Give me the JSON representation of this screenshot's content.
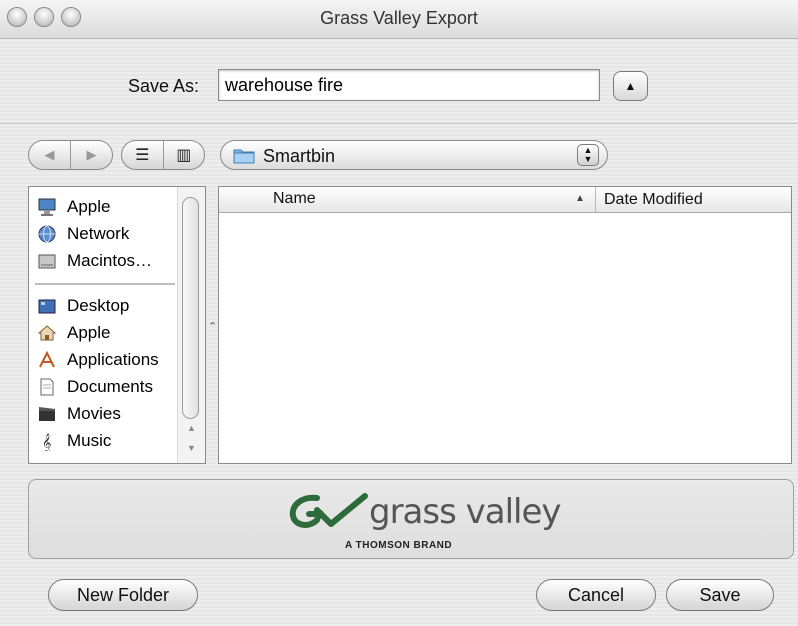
{
  "window": {
    "title": "Grass Valley Export"
  },
  "save_as": {
    "label": "Save As:",
    "value": "warehouse fire"
  },
  "toolbar": {
    "location_popup": "Smartbin"
  },
  "sidebar": {
    "items": [
      {
        "label": "Apple",
        "icon": "computer-icon"
      },
      {
        "label": "Network",
        "icon": "network-globe-icon"
      },
      {
        "label": "Macintos…",
        "icon": "hard-drive-icon"
      },
      {
        "label": "Desktop",
        "icon": "desktop-icon"
      },
      {
        "label": "Apple",
        "icon": "home-icon"
      },
      {
        "label": "Applications",
        "icon": "applications-icon"
      },
      {
        "label": "Documents",
        "icon": "documents-icon"
      },
      {
        "label": "Movies",
        "icon": "movies-icon"
      },
      {
        "label": "Music",
        "icon": "music-icon"
      }
    ]
  },
  "file_list": {
    "columns": [
      "Name",
      "Date Modified"
    ]
  },
  "logo": {
    "text": "grass valley",
    "brand": "A THOMSON BRAND"
  },
  "buttons": {
    "new_folder": "New Folder",
    "cancel": "Cancel",
    "save": "Save"
  }
}
